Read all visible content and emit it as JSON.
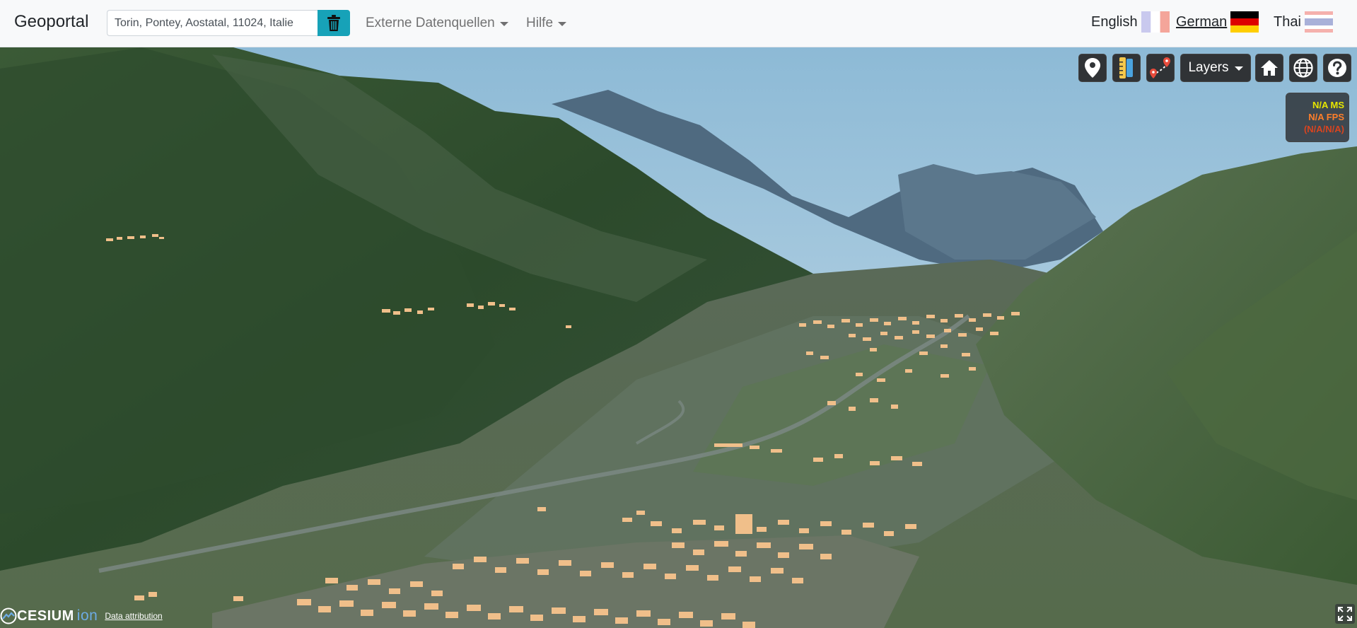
{
  "header": {
    "brand": "Geoportal",
    "search": {
      "value": "Torin, Pontey, Aostatal, 11024, Italie",
      "placeholder": ""
    },
    "menus": [
      {
        "label": "Externe Datenquellen"
      },
      {
        "label": "Hilfe"
      }
    ],
    "languages": [
      {
        "label": "English",
        "flag": "flag-fr-icon",
        "active": false
      },
      {
        "label": "German",
        "flag": "flag-de-icon",
        "active": true
      },
      {
        "label": "Thai",
        "flag": "flag-th-icon",
        "active": false
      }
    ]
  },
  "toolbar": {
    "buttons": [
      {
        "icon": "map-pin-icon"
      },
      {
        "icon": "measure-ruler-icon"
      },
      {
        "icon": "route-icon"
      },
      {
        "icon": "home-icon"
      },
      {
        "icon": "globe-icon"
      },
      {
        "icon": "help-icon"
      }
    ],
    "layers_label": "Layers"
  },
  "performance": {
    "ms": "N/A MS",
    "fps": "N/A FPS",
    "min": "(N/A/N/A)"
  },
  "credits": {
    "logo_text": "CESIUM",
    "logo_suffix": "ion",
    "attribution": "Data attribution"
  },
  "colors": {
    "trash_button": "#17a2b8",
    "toolbar_button": "#303336",
    "building": "#f0bf8a",
    "sky": "#9fc5de"
  }
}
